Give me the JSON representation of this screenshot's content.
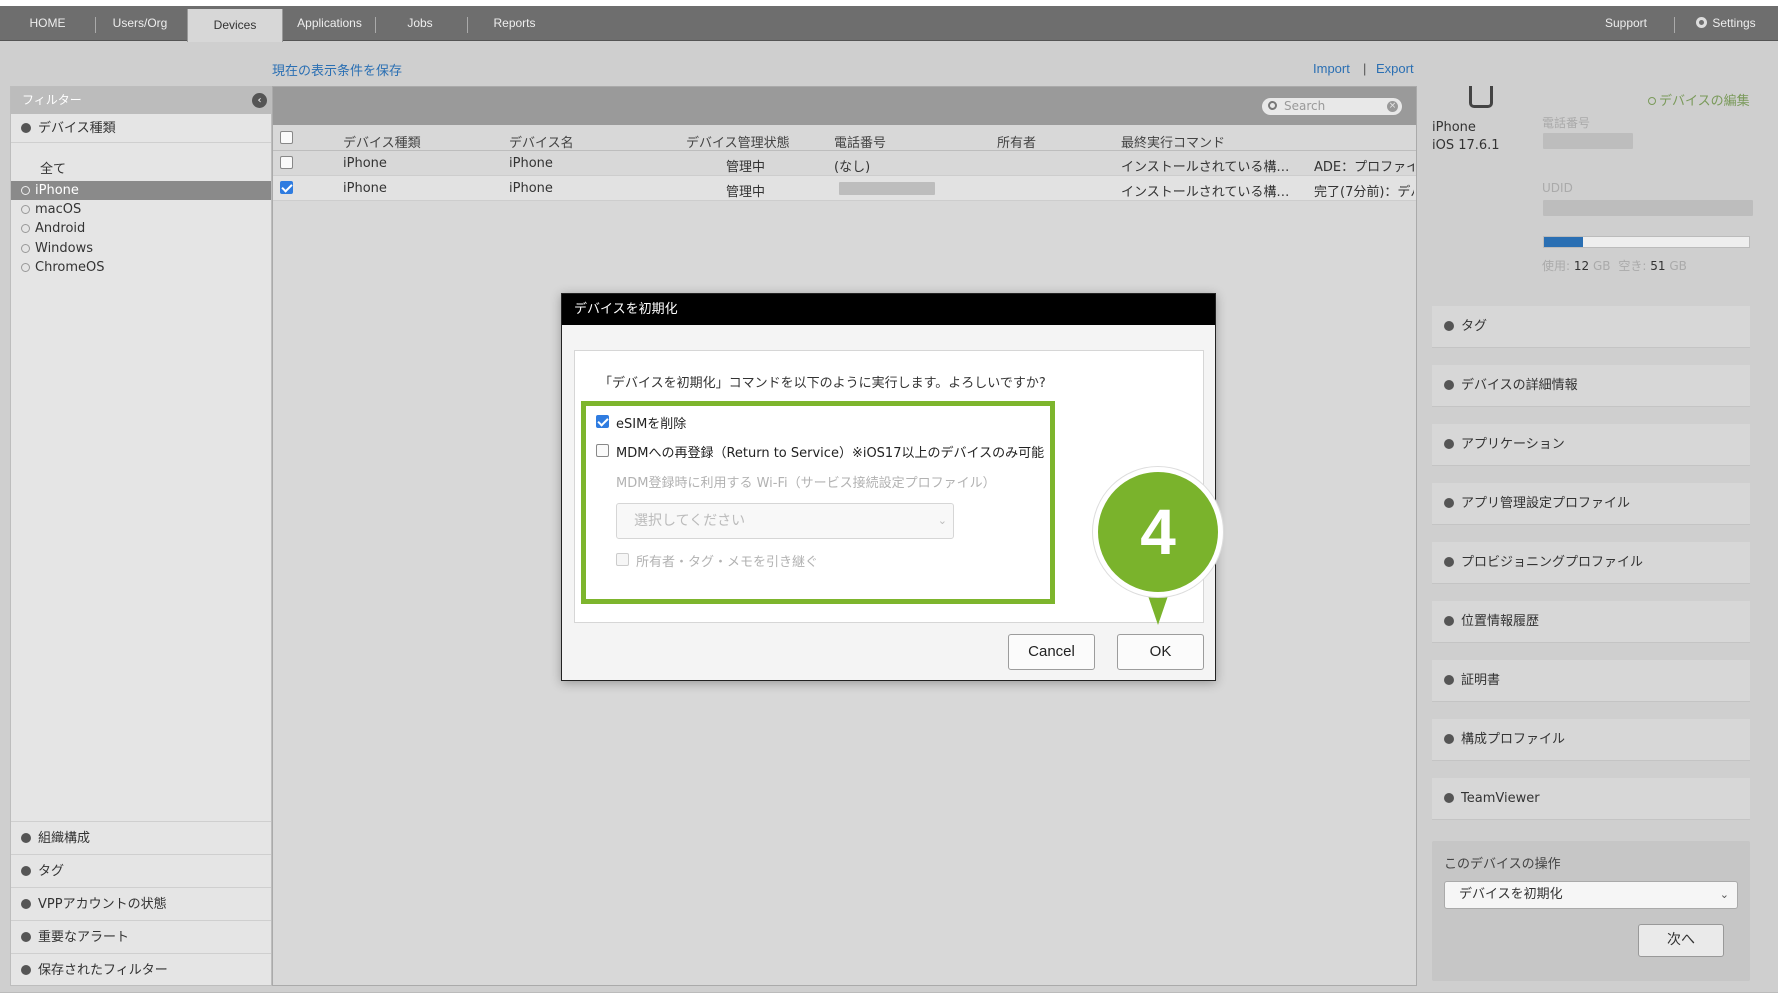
{
  "nav": {
    "tabs": [
      "HOME",
      "Users/Org",
      "Devices",
      "Applications",
      "Jobs",
      "Reports"
    ],
    "active": "Devices",
    "right": {
      "support": "Support",
      "settings": "Settings"
    }
  },
  "links": {
    "save_filter": "現在の表示条件を保存",
    "import": "Import",
    "separator": "|",
    "export": "Export"
  },
  "filter": {
    "header": "フィルター",
    "section_title": "デバイス種類",
    "all_label": "全て",
    "items": [
      "iPhone",
      "macOS",
      "Android",
      "Windows",
      "ChromeOS"
    ],
    "selected": "iPhone",
    "bottom_sections": [
      "組織構成",
      "タグ",
      "VPPアカウントの状態",
      "重要なアラート",
      "保存されたフィルター"
    ]
  },
  "grid": {
    "search_placeholder": "Search",
    "columns": [
      "デバイス種類",
      "デバイス名",
      "デバイス管理状態",
      "電話番号",
      "所有者",
      "最終実行コマンド"
    ],
    "rows": [
      {
        "type": "iPhone",
        "name": "iPhone",
        "status": "管理中",
        "phone": "(なし)",
        "owner": "",
        "command": "インストールされている構…",
        "extra": "ADE：プロファイ",
        "checked": false
      },
      {
        "type": "iPhone",
        "name": "iPhone",
        "status": "管理中",
        "phone": "",
        "owner": "",
        "command": "インストールされている構…",
        "extra": "完了(7分前)：デバ",
        "checked": true
      }
    ]
  },
  "device_panel": {
    "model": "iPhone",
    "os": "iOS 17.6.1",
    "edit_link": "デバイスの編集",
    "phone_label": "電話番号",
    "udid_label": "UDID",
    "storage": {
      "used_label": "使用:",
      "used_value": "12",
      "free_label": "空き:",
      "free_value": "51",
      "unit": "GB",
      "used_fraction": 0.19
    },
    "sections": [
      "タグ",
      "デバイスの詳細情報",
      "アプリケーション",
      "アプリ管理設定プロファイル",
      "プロビジョニングプロファイル",
      "位置情報履歴",
      "証明書",
      "構成プロファイル",
      "TeamViewer"
    ],
    "ops_title": "このデバイスの操作",
    "ops_selected": "デバイスを初期化",
    "next_button": "次へ"
  },
  "dialog": {
    "title": "デバイスを初期化",
    "message": "「デバイスを初期化」コマンドを以下のように実行します。よろしいですか?",
    "option_esim": "eSIMを削除",
    "option_esim_checked": true,
    "option_rts": "MDMへの再登録（Return to Service）※iOS17以上のデバイスのみ可能",
    "option_rts_checked": false,
    "wifi_label": "MDM登録時に利用する Wi-Fi（サービス接続設定プロファイル）",
    "wifi_placeholder": "選択してください",
    "inherit_label": "所有者・タグ・メモを引き継ぐ",
    "cancel": "Cancel",
    "ok": "OK"
  },
  "callout": {
    "step": "4"
  },
  "colors": {
    "accent_green": "#7ab32c",
    "link_blue": "#2a6fb3",
    "check_blue": "#2f7ce0",
    "topnav": "#6e6e6e"
  }
}
